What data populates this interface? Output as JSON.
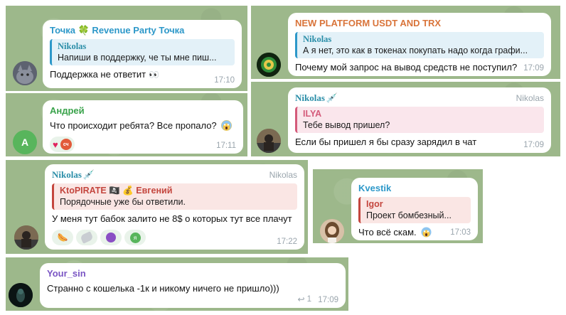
{
  "c1": {
    "sender": "Точка 🍀 Revenue Party Точка",
    "reply_name": "Nikolas",
    "reply_text": "Напиши в поддержку, че ты мне пиш...",
    "message": "Поддержка не ответит",
    "time": "17:10"
  },
  "c2": {
    "sender": "Андрей",
    "avatar_letter": "А",
    "message": "Что происходит ребята? Все пропало?",
    "reactions": [
      "heart",
      "сч"
    ],
    "time": "17:11"
  },
  "c3": {
    "sender": "NEW PLATFORM USDT AND TRX",
    "reply_name": "Nikolas",
    "reply_text": "А я нет, это как в токенах покупать надо когда графи...",
    "message": "Почему мой запрос на вывод средств не поступил?",
    "time": "17:09"
  },
  "c4": {
    "sender": "Nikolas",
    "role": "Nikolas",
    "reply_name": "ILYA",
    "reply_text": "Тебе вывод пришел?",
    "message": "Если бы пришел я бы сразу зарядил в чат",
    "time": "17:09"
  },
  "c5": {
    "sender": "Nikolas",
    "role": "Nikolas",
    "reply_name": "KtoPIRATE 🏴‍☠️ 💰 Евгений",
    "reply_text": "Порядочные уже бы ответили.",
    "message": "У меня тут бабок залито не 8$ о которых тут все плачут",
    "reactions": [
      "hotdog",
      "cast",
      "devil",
      "я"
    ],
    "time": "17:22"
  },
  "c6": {
    "sender": "Kvestik",
    "reply_name": "Igor",
    "reply_text": "Проект бомбезный...",
    "message": "Что всё скам.",
    "time": "17:03"
  },
  "c7": {
    "sender": "Your_sin",
    "message": "Странно с кошелька -1к и никому ничего не пришло)))",
    "reply_count": "1",
    "time": "17:09"
  },
  "colors": {
    "panel_bg": "#9db88b",
    "c1_sender": "#2d98c9",
    "c2_sender": "#3aa34b",
    "c3_sender": "#d9743a",
    "c4_reply": "#d45a7a",
    "c5_reply": "#c4463e",
    "c6_sender": "#2d98c9",
    "c6_reply": "#c4463e",
    "c7_sender": "#7a55c4",
    "nikolas": "#2b8ea8"
  },
  "icons": [
    "clover-icon",
    "eyes-icon",
    "screaming-face-icon",
    "heart-icon",
    "syringe-icon",
    "pirate-flag-icon",
    "money-bag-icon",
    "reply-arrow-icon"
  ]
}
